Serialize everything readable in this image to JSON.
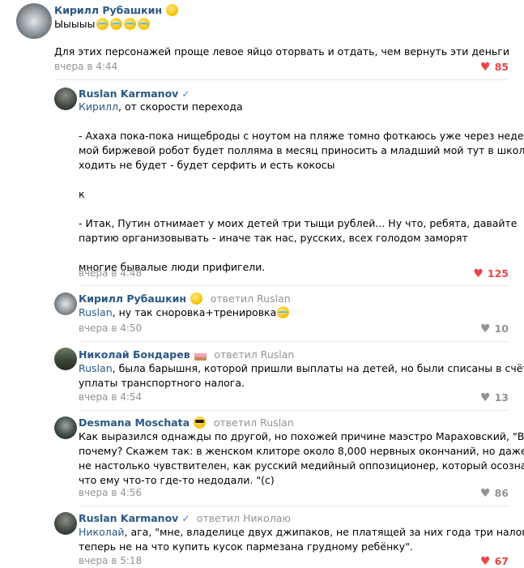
{
  "comments": [
    {
      "author": "Кирилл Рубашкин",
      "first_line": "Ыыыыы",
      "text": "Для этих персонажей проще левое яйцо оторвать и отдать, чем вернуть эти деньги",
      "time": "вчера в 4:44",
      "likes": "85",
      "liked": true
    },
    {
      "author": "Ruslan Karmanov",
      "mention": "Кирилл",
      "paragraphs": [
        ", от скорости перехода",
        "",
        "- Ахаха пока-пока нищеброды с ноутом на пляже томно фоткаюсь уже через недельку",
        "мой биржевой робот будет полляма в месяц приносить а младший мой тут в школу",
        "ходить не будет - будет серфить и есть кокосы",
        "",
        "к",
        "",
        "- Итак, Путин отнимает у моих детей три тыщи рублей... Ну что, ребята, давайте",
        "партию организовывать - иначе так нас, русских, всех голодом заморят",
        "",
        "многие бывалые люди прифигели."
      ],
      "time": "вчера в 4:48",
      "likes": "125",
      "liked": true
    },
    {
      "author": "Кирилл Рубашкин",
      "replied": "ответил Ruslan",
      "mention": "Ruslan",
      "text": ", ну так сноровка+тренировка",
      "time": "вчера в 4:50",
      "likes": "10",
      "liked": false
    },
    {
      "author": "Николай Бондарев",
      "replied": "ответил Ruslan",
      "mention": "Ruslan",
      "paragraphs": [
        ", была барышня, которой пришли выплаты на детей, но были списаны в счёт",
        "уплаты транспортного налога."
      ],
      "time": "вчера в 4:54",
      "likes": "13",
      "liked": false
    },
    {
      "author": "Desmana Moschata",
      "replied": "ответил Ruslan",
      "paragraphs": [
        "Как выразился однажды по другой, но похожей причине маэстро Мараховский, \"Всё",
        "почему? Скажем так: в женском клиторе около 8,000 нервных окончаний, но даже он",
        "не настолько чувствителен, как русский медийный оппозиционер, который осознал,",
        "что ему что-то где-то недодали. \"(с)"
      ],
      "time": "вчера в 4:56",
      "likes": "86",
      "liked": false
    },
    {
      "author": "Ruslan Karmanov",
      "replied": "ответил Николаю",
      "mention": "Николай",
      "paragraphs": [
        ", ага, \"мне, владелице двух джипаков, не платящей за них года три налоги,",
        "теперь не на что купить кусок пармезана грудному ребёнку\"."
      ],
      "time": "вчера в 5:18",
      "likes": "67",
      "liked": true
    }
  ],
  "colors": {
    "link": "#2a5885",
    "meta": "#939393",
    "liked": "#e64646",
    "separator": "#e7e8ec"
  }
}
